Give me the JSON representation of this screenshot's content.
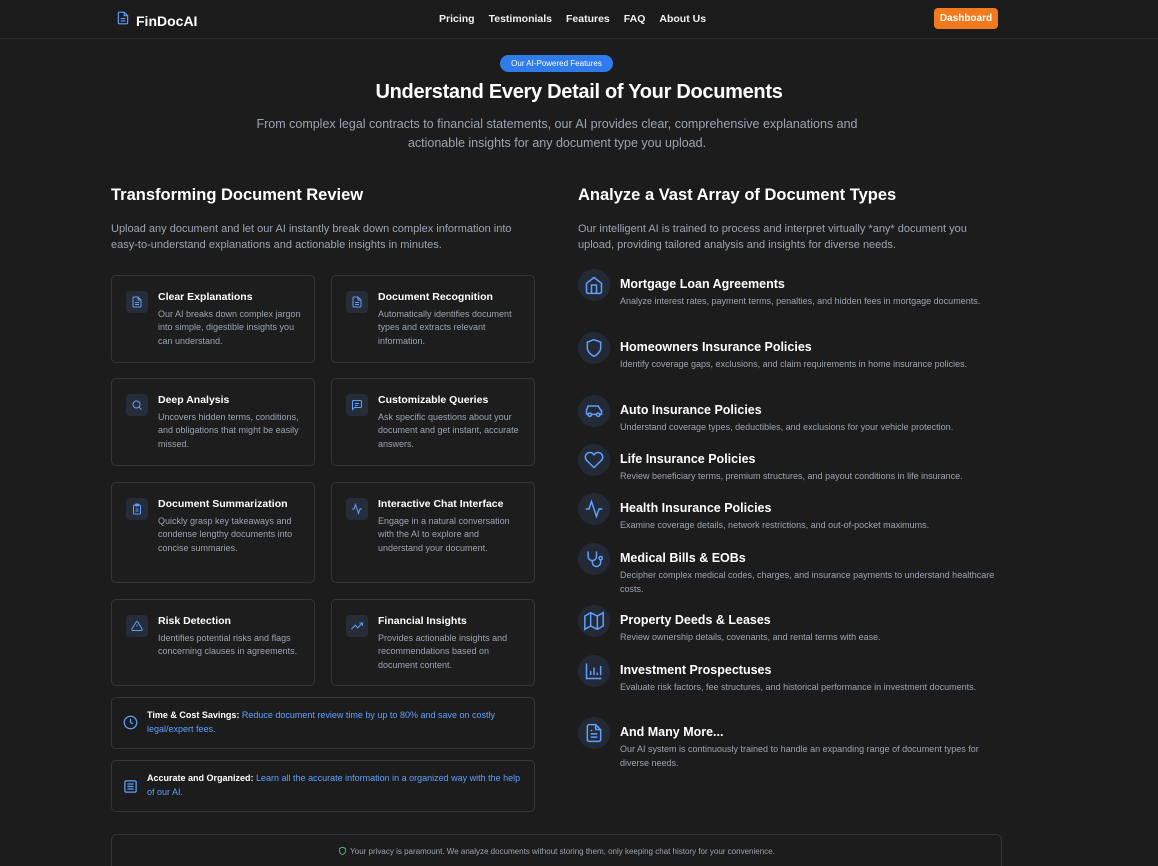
{
  "nav": {
    "logo_text": "FinDocAI",
    "links": [
      "Pricing",
      "Testimonials",
      "Features",
      "FAQ",
      "About Us"
    ],
    "dashboard_label": "Dashboard"
  },
  "hero": {
    "badge": "Our AI-Powered Features",
    "title": "Understand Every Detail of Your Documents",
    "subtitle": "From complex legal contracts to financial statements, our AI provides clear, comprehensive explanations and actionable insights for any document type you upload."
  },
  "left": {
    "title": "Transforming Document Review",
    "description": "Upload any document and let our AI instantly break down complex information into easy-to-understand explanations and actionable insights in minutes.",
    "features": [
      {
        "title": "Clear Explanations",
        "desc": "Our AI breaks down complex jargon into simple, digestible insights you can understand.",
        "icon": "document-icon"
      },
      {
        "title": "Document Recognition",
        "desc": "Automatically identifies document types and extracts relevant information.",
        "icon": "document-icon"
      },
      {
        "title": "Deep Analysis",
        "desc": "Uncovers hidden terms, conditions, and obligations that might be easily missed.",
        "icon": "search-icon"
      },
      {
        "title": "Customizable Queries",
        "desc": "Ask specific questions about your document and get instant, accurate answers.",
        "icon": "chat-icon"
      },
      {
        "title": "Document Summarization",
        "desc": "Quickly grasp key takeaways and condense lengthy documents into concise summaries.",
        "icon": "clipboard-icon"
      },
      {
        "title": "Interactive Chat Interface",
        "desc": "Engage in a natural conversation with the AI to explore and understand your document.",
        "icon": "activity-icon"
      },
      {
        "title": "Risk Detection",
        "desc": "Identifies potential risks and flags concerning clauses in agreements.",
        "icon": "warning-icon"
      },
      {
        "title": "Financial Insights",
        "desc": "Provides actionable insights and recommendations based on document content.",
        "icon": "trending-up-icon"
      }
    ],
    "savings": {
      "label": "Time & Cost Savings:",
      "text": " Reduce document review time by up to 80% and save on costly legal/expert fees.",
      "icon": "clock-icon"
    },
    "organized": {
      "label": "Accurate and Organized:",
      "text": " Learn all the accurate information in a organized way with the help of our AI.",
      "icon": "list-icon"
    }
  },
  "right": {
    "title": "Analyze a Vast Array of Document Types",
    "description": "Our intelligent AI is trained to process and interpret virtually *any* document you upload, providing tailored analysis and insights for diverse needs.",
    "types": [
      {
        "title": "Mortgage Loan Agreements",
        "desc": "Analyze interest rates, payment terms, penalties, and hidden fees in mortgage documents.",
        "icon": "home-icon"
      },
      {
        "title": "Homeowners Insurance Policies",
        "desc": "Identify coverage gaps, exclusions, and claim requirements in home insurance policies.",
        "icon": "shield-icon"
      },
      {
        "title": "Auto Insurance Policies",
        "desc": "Understand coverage types, deductibles, and exclusions for your vehicle protection.",
        "icon": "car-icon"
      },
      {
        "title": "Life Insurance Policies",
        "desc": "Review beneficiary terms, premium structures, and payout conditions in life insurance.",
        "icon": "heart-icon"
      },
      {
        "title": "Health Insurance Policies",
        "desc": "Examine coverage details, network restrictions, and out-of-pocket maximums.",
        "icon": "pulse-icon"
      },
      {
        "title": "Medical Bills & EOBs",
        "desc": "Decipher complex medical codes, charges, and insurance payments to understand healthcare costs.",
        "icon": "stethoscope-icon"
      },
      {
        "title": "Property Deeds & Leases",
        "desc": "Review ownership details, covenants, and rental terms with ease.",
        "icon": "map-icon"
      },
      {
        "title": "Investment Prospectuses",
        "desc": "Evaluate risk factors, fee structures, and historical performance in investment documents.",
        "icon": "bar-chart-icon"
      },
      {
        "title": "And Many More...",
        "desc": "Our AI system is continuously trained to handle an expanding range of document types for diverse needs.",
        "icon": "file-text-icon"
      }
    ]
  },
  "privacy": {
    "text": "Your privacy is paramount. We analyze documents without storing them, only keeping chat history for your convenience.",
    "icon": "shield-icon"
  },
  "colors": {
    "accent": "#2f7bea",
    "cta": "#f07a1c",
    "background": "#1c1c1c",
    "icon_blue": "#5ea0ff"
  }
}
